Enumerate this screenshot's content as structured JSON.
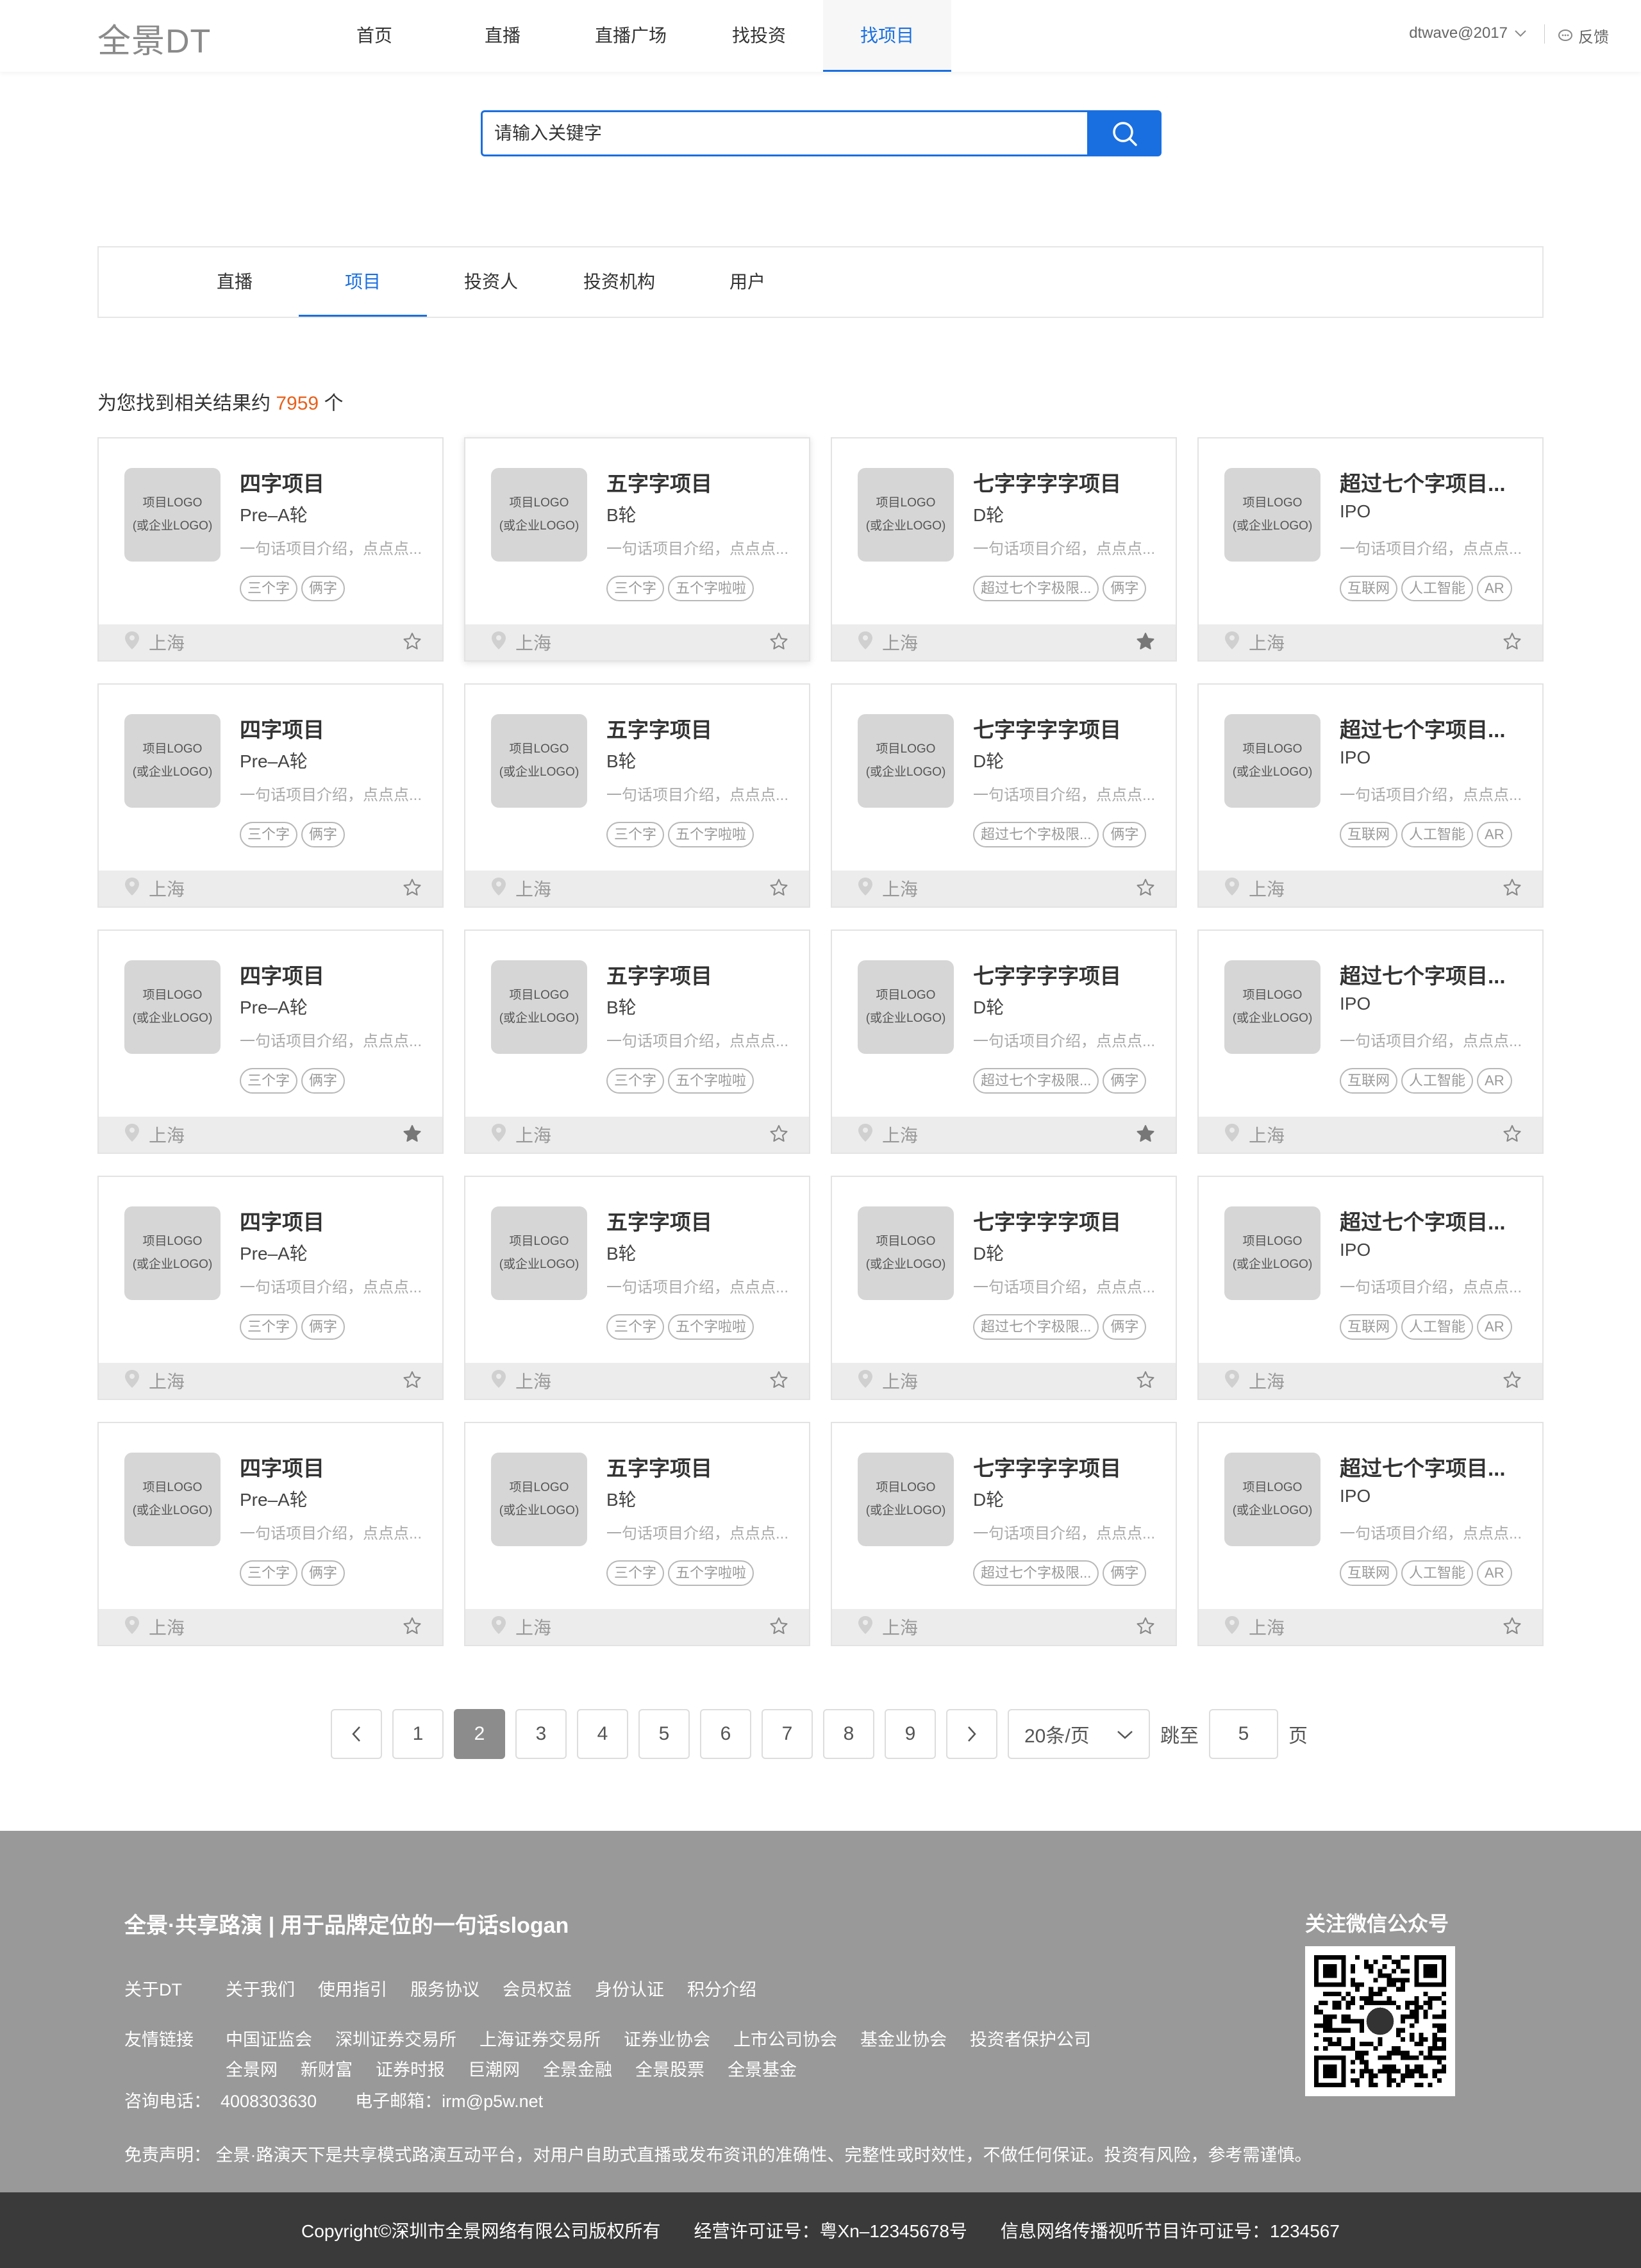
{
  "header": {
    "logo": "全景DT",
    "nav": [
      "首页",
      "直播",
      "直播广场",
      "找投资",
      "找项目"
    ],
    "active_nav": 4,
    "user": "dtwave@2017",
    "feedback": "反馈"
  },
  "search": {
    "placeholder": "请输入关键字"
  },
  "tabs": [
    "直播",
    "项目",
    "投资人",
    "投资机构",
    "用户"
  ],
  "active_tab": 1,
  "result": {
    "prefix": "为您找到相关结果约",
    "count": "7959",
    "suffix": "个"
  },
  "card_logo": [
    "项目LOGO",
    "(或企业LOGO)"
  ],
  "card_templates": [
    {
      "title": "四字项目",
      "round": "Pre–A轮",
      "desc": "一句话项目介绍，点点点...",
      "tags": [
        "三个字",
        "俩字"
      ],
      "location": "上海"
    },
    {
      "title": "五字字项目",
      "round": "B轮",
      "desc": "一句话项目介绍，点点点...",
      "tags": [
        "三个字",
        "五个字啦啦"
      ],
      "location": "上海"
    },
    {
      "title": "七字字字字项目",
      "round": "D轮",
      "desc": "一句话项目介绍，点点点...",
      "tags": [
        "超过七个字极限...",
        "俩字"
      ],
      "location": "上海"
    },
    {
      "title": "超过七个字项目...",
      "round": "IPO",
      "desc": "一句话项目介绍，点点点...",
      "tags": [
        "互联网",
        "人工智能",
        "AR"
      ],
      "location": "上海"
    }
  ],
  "rows": 5,
  "favorited": [
    [
      0,
      2
    ],
    [
      2,
      0
    ],
    [
      2,
      2
    ]
  ],
  "pagination": {
    "prev": "‹",
    "next": "›",
    "pages": [
      "1",
      "2",
      "3",
      "4",
      "5",
      "6",
      "7",
      "8",
      "9"
    ],
    "current": "2",
    "page_size": "20条/页",
    "jump_label": "跳至",
    "jump_value": "5",
    "page_label": "页"
  },
  "footer": {
    "slogan": "全景·共享路演 | 用于品牌定位的一句话slogan",
    "about_label": "关于DT",
    "about_links": [
      "关于我们",
      "使用指引",
      "服务协议",
      "会员权益",
      "身份认证",
      "积分介绍"
    ],
    "friend_label": "友情链接",
    "friend_links": [
      "中国证监会",
      "深圳证券交易所",
      "上海证券交易所",
      "证券业协会",
      "上市公司协会",
      "基金业协会",
      "投资者保护公司",
      "全景网",
      "新财富",
      "证券时报",
      "巨潮网",
      "全景金融",
      "全景股票",
      "全景基金"
    ],
    "contact": "咨询电话：  4008303630        电子邮箱：irm@p5w.net",
    "disclaimer": "免责声明：  全景·路演天下是共享模式路演互动平台，对用户自助式直播或发布资讯的准确性、完整性或时效性，不做任何保证。投资有风险，参考需谨慎。",
    "qr_title": "关注微信公众号",
    "copyright": "Copyright©深圳市全景网络有限公司版权所有",
    "license": "经营许可证号：粤Xn–12345678号",
    "av_license": "信息网络传播视听节目许可证号：1234567"
  }
}
